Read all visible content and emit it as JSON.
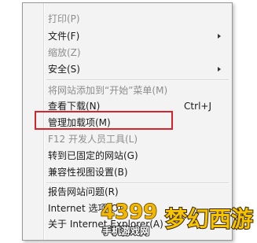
{
  "menu": {
    "items": [
      {
        "label": "打印(P)",
        "disabled": true
      },
      {
        "label": "文件(F)",
        "submenu": true
      },
      {
        "label": "缩放(Z)",
        "disabled": true
      },
      {
        "label": "安全(S)",
        "submenu": true
      },
      {
        "label": "将网站添加到“开始”菜单(M)",
        "disabled": true
      },
      {
        "label": "查看下载(N)",
        "shortcut": "Ctrl+J"
      },
      {
        "label": "管理加载项(M)"
      },
      {
        "label": "F12 开发人员工具(L)",
        "disabled": true
      },
      {
        "label": "转到已固定的网站(G)"
      },
      {
        "label": "兼容性视图设置(B)"
      },
      {
        "label": "报告网站问题(R)"
      },
      {
        "label": "Internet 选项(O)"
      },
      {
        "label": "关于 Internet Explorer(A)"
      }
    ]
  },
  "highlight": {
    "target": "管理加载项(M)",
    "color": "#d6242c"
  },
  "watermark": {
    "brand_number": "4399",
    "brand_sub": "手机游戏网",
    "logo_text": "梦幻西游",
    "number_color": "#f2b700",
    "logo_color": "#f7c400"
  }
}
